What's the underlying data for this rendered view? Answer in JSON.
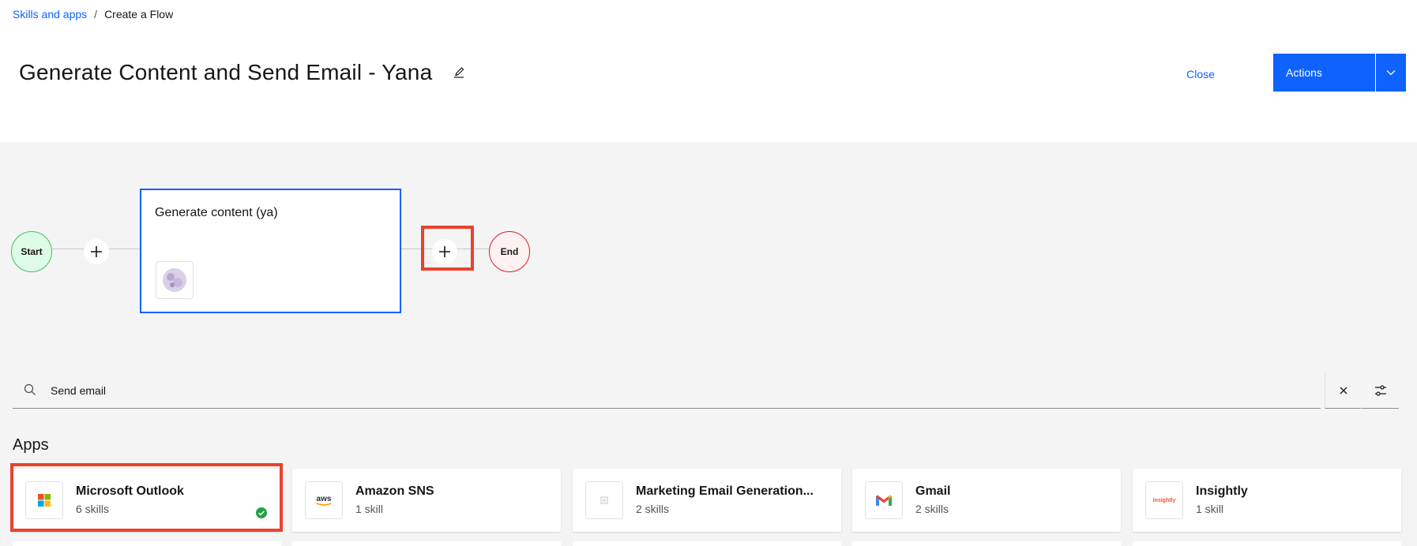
{
  "breadcrumb": {
    "parent": "Skills and apps",
    "separator": "/",
    "current": "Create a Flow"
  },
  "page": {
    "title": "Generate Content and Send Email - Yana"
  },
  "header": {
    "close_label": "Close",
    "actions_label": "Actions"
  },
  "flow": {
    "start_label": "Start",
    "end_label": "End",
    "skill_card_title": "Generate content (ya)"
  },
  "search": {
    "value": "Send email"
  },
  "apps_section": {
    "title": "Apps",
    "items": [
      {
        "name": "Microsoft Outlook",
        "count": "6 skills",
        "logo": "microsoft-logo",
        "connected": true
      },
      {
        "name": "Amazon SNS",
        "count": "1 skill",
        "logo": "aws-logo",
        "logo_text": "aws"
      },
      {
        "name": "Marketing Email Generation...",
        "count": "2 skills",
        "logo": "generic-app-logo"
      },
      {
        "name": "Gmail",
        "count": "2 skills",
        "logo": "gmail-logo"
      },
      {
        "name": "Insightly",
        "count": "1 skill",
        "logo": "insightly-logo",
        "logo_text": "insightly"
      }
    ]
  },
  "colors": {
    "primary": "#0f62fe",
    "highlight": "#e8432d",
    "start_bg": "#defbe6",
    "end_bg": "#fff1f1",
    "success": "#24a148"
  }
}
